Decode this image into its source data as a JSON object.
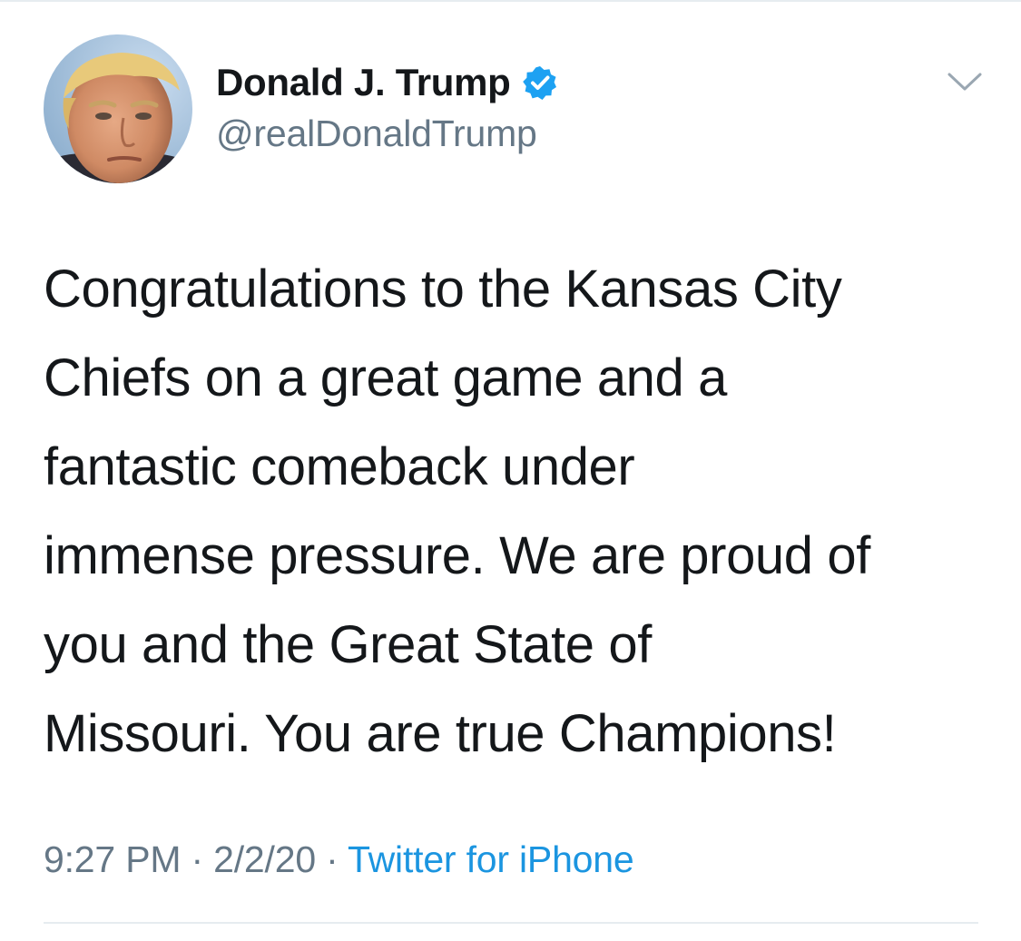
{
  "author": {
    "display_name": "Donald J. Trump",
    "handle": "@realDonaldTrump",
    "verified": true,
    "verified_icon": "verified-badge-icon",
    "avatar_icon": "profile-photo"
  },
  "tweet": {
    "lines": [
      "Congratulations to the Kansas City",
      "Chiefs on a great game and a",
      "fantastic comeback under",
      "immense pressure. We are proud of",
      "you and the Great State of",
      "Missouri. You are true Champions!"
    ]
  },
  "meta": {
    "time": "9:27 PM",
    "separator": " · ",
    "date": "2/2/20",
    "source": "Twitter for iPhone"
  },
  "menu": {
    "icon": "chevron-down-icon"
  },
  "colors": {
    "text": "#14171a",
    "secondary": "#657786",
    "link": "#1b95e0",
    "verified": "#1da1f2",
    "divider": "#e6ecf0"
  }
}
